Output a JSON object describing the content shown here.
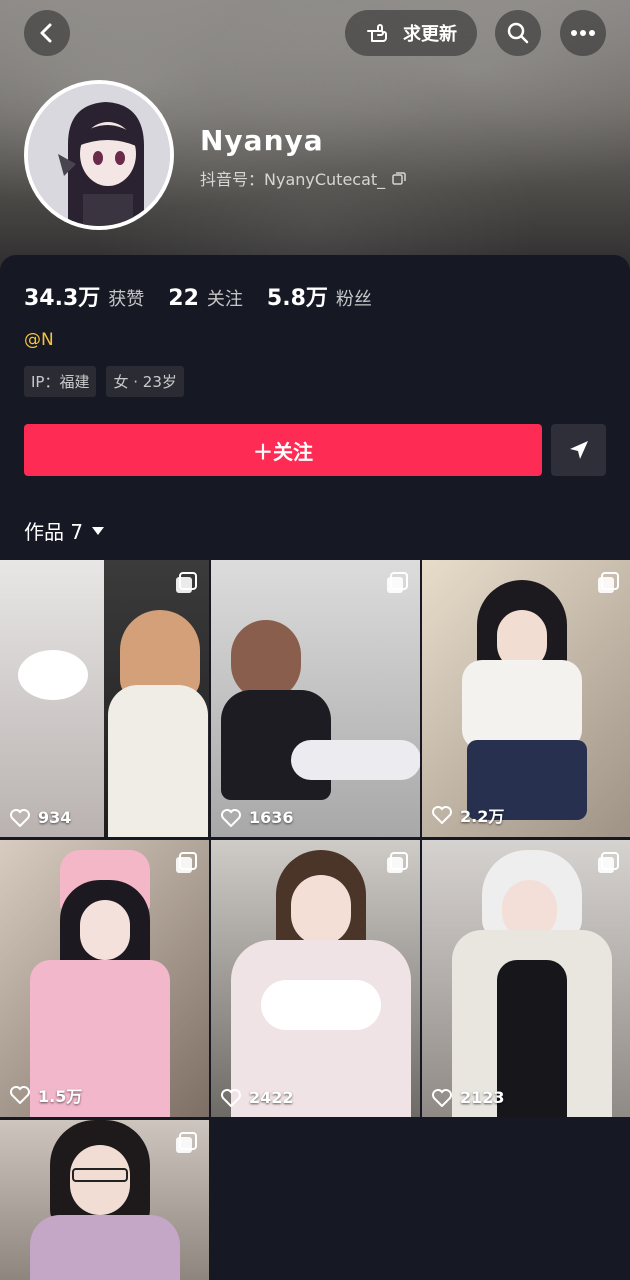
{
  "header": {
    "request_update_label": "求更新",
    "icons": [
      "back-icon",
      "hand-point-icon",
      "search-icon",
      "more-icon"
    ]
  },
  "profile": {
    "nickname": "Nyanya",
    "douyin_id_label": "抖音号：NyanyCutecat_",
    "mention": "@N",
    "tags": [
      "IP：福建",
      "女 · 23岁"
    ]
  },
  "stats": [
    {
      "value": "34.3万",
      "label": "获赞"
    },
    {
      "value": "22",
      "label": "关注"
    },
    {
      "value": "5.8万",
      "label": "粉丝"
    }
  ],
  "actions": {
    "follow_label": "＋关注"
  },
  "works": {
    "tab_label": "作品 7"
  },
  "videos": [
    {
      "likes": "934"
    },
    {
      "likes": "1636"
    },
    {
      "likes": "2.2万"
    },
    {
      "likes": "1.5万"
    },
    {
      "likes": "2422"
    },
    {
      "likes": "2123"
    },
    {
      "likes": ""
    }
  ],
  "colors": {
    "accent": "#fe2c55",
    "background": "#161823",
    "mention": "#f5c342"
  }
}
